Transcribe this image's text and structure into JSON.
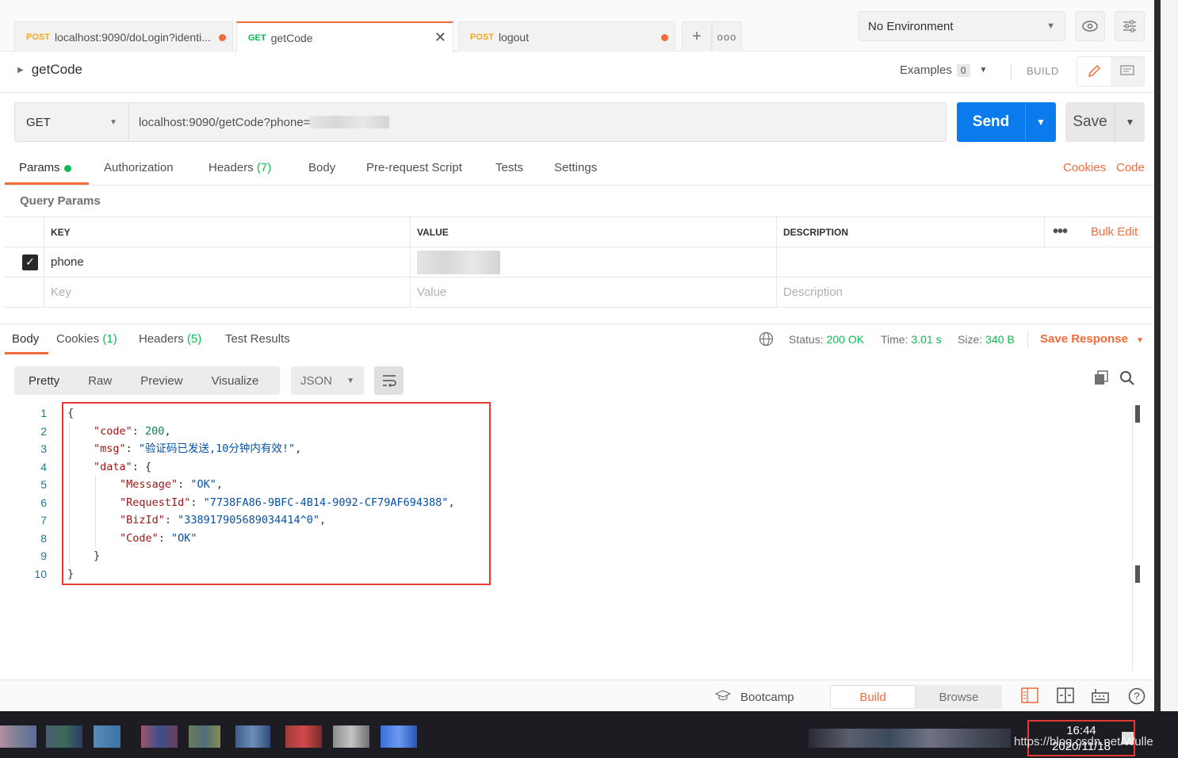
{
  "tabs": [
    {
      "method": "POST",
      "title": "localhost:9090/doLogin?identi...",
      "unsaved": true
    },
    {
      "method": "GET",
      "title": "getCode",
      "active": true
    },
    {
      "method": "POST",
      "title": "logout",
      "unsaved": true
    }
  ],
  "tabbar": {
    "add_icon": "plus-icon",
    "more_icon": "ellipsis-icon"
  },
  "environment": {
    "selected": "No Environment"
  },
  "request": {
    "name": "getCode",
    "examples_label": "Examples",
    "examples_count": "0",
    "build_label": "BUILD",
    "method": "GET",
    "url": "localhost:9090/getCode?phone=",
    "send_label": "Send",
    "save_label": "Save"
  },
  "request_tabs": {
    "params": "Params",
    "authorization": "Authorization",
    "headers": "Headers",
    "headers_count": "(7)",
    "body": "Body",
    "prerequest": "Pre-request Script",
    "tests": "Tests",
    "settings": "Settings",
    "cookies_link": "Cookies",
    "code_link": "Code"
  },
  "query_params": {
    "title": "Query Params",
    "headers": {
      "key": "KEY",
      "value": "VALUE",
      "description": "DESCRIPTION",
      "bulk_edit": "Bulk Edit"
    },
    "rows": [
      {
        "key": "phone",
        "value": "",
        "description": "",
        "checked": true
      }
    ],
    "placeholders": {
      "key": "Key",
      "value": "Value",
      "description": "Description"
    }
  },
  "response": {
    "tabs": {
      "body": "Body",
      "cookies": "Cookies",
      "cookies_count": "(1)",
      "headers": "Headers",
      "headers_count": "(5)",
      "test_results": "Test Results"
    },
    "status_label": "Status:",
    "status": "200 OK",
    "time_label": "Time:",
    "time": "3.01 s",
    "size_label": "Size:",
    "size": "340 B",
    "save_response": "Save Response",
    "views": [
      "Pretty",
      "Raw",
      "Preview",
      "Visualize"
    ],
    "format": "JSON",
    "code_lines": [
      {
        "n": "1",
        "indent": 0,
        "parts": [
          [
            "p",
            "{"
          ]
        ]
      },
      {
        "n": "2",
        "indent": 1,
        "parts": [
          [
            "k",
            "\"code\""
          ],
          [
            "p",
            ": "
          ],
          [
            "n",
            "200"
          ],
          [
            "p",
            ","
          ]
        ]
      },
      {
        "n": "3",
        "indent": 1,
        "parts": [
          [
            "k",
            "\"msg\""
          ],
          [
            "p",
            ": "
          ],
          [
            "s",
            "\"验证码已发送,10分钟内有效!\""
          ],
          [
            "p",
            ","
          ]
        ]
      },
      {
        "n": "4",
        "indent": 1,
        "parts": [
          [
            "k",
            "\"data\""
          ],
          [
            "p",
            ": {"
          ]
        ]
      },
      {
        "n": "5",
        "indent": 2,
        "parts": [
          [
            "k",
            "\"Message\""
          ],
          [
            "p",
            ": "
          ],
          [
            "s",
            "\"OK\""
          ],
          [
            "p",
            ","
          ]
        ]
      },
      {
        "n": "6",
        "indent": 2,
        "parts": [
          [
            "k",
            "\"RequestId\""
          ],
          [
            "p",
            ": "
          ],
          [
            "s",
            "\"7738FA86-9BFC-4B14-9092-CF79AF694388\""
          ],
          [
            "p",
            ","
          ]
        ]
      },
      {
        "n": "7",
        "indent": 2,
        "parts": [
          [
            "k",
            "\"BizId\""
          ],
          [
            "p",
            ": "
          ],
          [
            "s",
            "\"338917905689034414^0\""
          ],
          [
            "p",
            ","
          ]
        ]
      },
      {
        "n": "8",
        "indent": 2,
        "parts": [
          [
            "k",
            "\"Code\""
          ],
          [
            "p",
            ": "
          ],
          [
            "s",
            "\"OK\""
          ]
        ]
      },
      {
        "n": "9",
        "indent": 1,
        "parts": [
          [
            "p",
            "}"
          ]
        ]
      },
      {
        "n": "10",
        "indent": 0,
        "parts": [
          [
            "p",
            "}"
          ]
        ]
      }
    ]
  },
  "footer": {
    "bootcamp": "Bootcamp",
    "build": "Build",
    "browse": "Browse"
  },
  "taskbar": {
    "time": "16:44",
    "date": "2020/11/18",
    "watermark": "https://blog.csdn.net/Wulle"
  },
  "colors": {
    "accent": "#f26b3a",
    "send": "#097bed",
    "success": "#0cbb52",
    "highlight_box": "#e53935"
  }
}
